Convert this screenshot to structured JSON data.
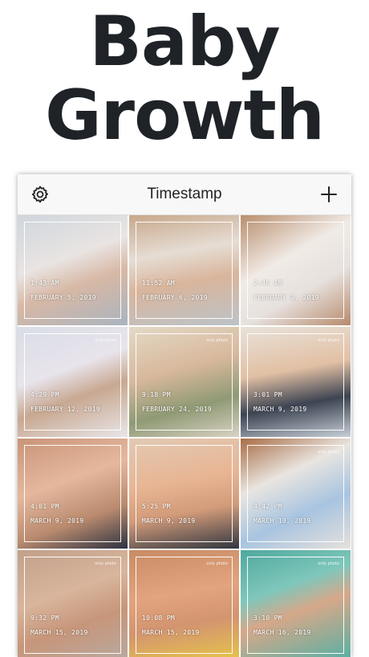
{
  "headline": {
    "line1": "Baby",
    "line2": "Growth"
  },
  "navbar": {
    "title": "Timestamp",
    "left_icon": "gear-icon",
    "right_icon": "plus-icon"
  },
  "photos": [
    {
      "time": "1:43 AM",
      "date": "FEBRUARY 5, 2019",
      "watermark": ""
    },
    {
      "time": "11:52 AM",
      "date": "FEBRUARY 6, 2019",
      "watermark": ""
    },
    {
      "time": "2:46 AM",
      "date": "FEBRUARY 9, 2019",
      "watermark": ""
    },
    {
      "time": "4:29 PM",
      "date": "FEBRUARY 12, 2019",
      "watermark": "only photo"
    },
    {
      "time": "9:18 PM",
      "date": "FEBRUARY 24, 2019",
      "watermark": "only photo"
    },
    {
      "time": "3:01 PM",
      "date": "MARCH 9, 2019",
      "watermark": "only photo"
    },
    {
      "time": "4:01 PM",
      "date": "MARCH 9, 2019",
      "watermark": ""
    },
    {
      "time": "5:25 PM",
      "date": "MARCH 9, 2019",
      "watermark": ""
    },
    {
      "time": "4:42 PM",
      "date": "MARCH 10, 2019",
      "watermark": "only photo"
    },
    {
      "time": "9:32 PM",
      "date": "MARCH 15, 2019",
      "watermark": "only photo"
    },
    {
      "time": "10:08 PM",
      "date": "MARCH 15, 2019",
      "watermark": "only photo"
    },
    {
      "time": "3:10 PM",
      "date": "MARCH 16, 2019",
      "watermark": "only photo"
    }
  ],
  "colors": {
    "text": "#1f2328",
    "navbar_bg": "#f8f8f8",
    "overlay_text": "#ffffff"
  }
}
